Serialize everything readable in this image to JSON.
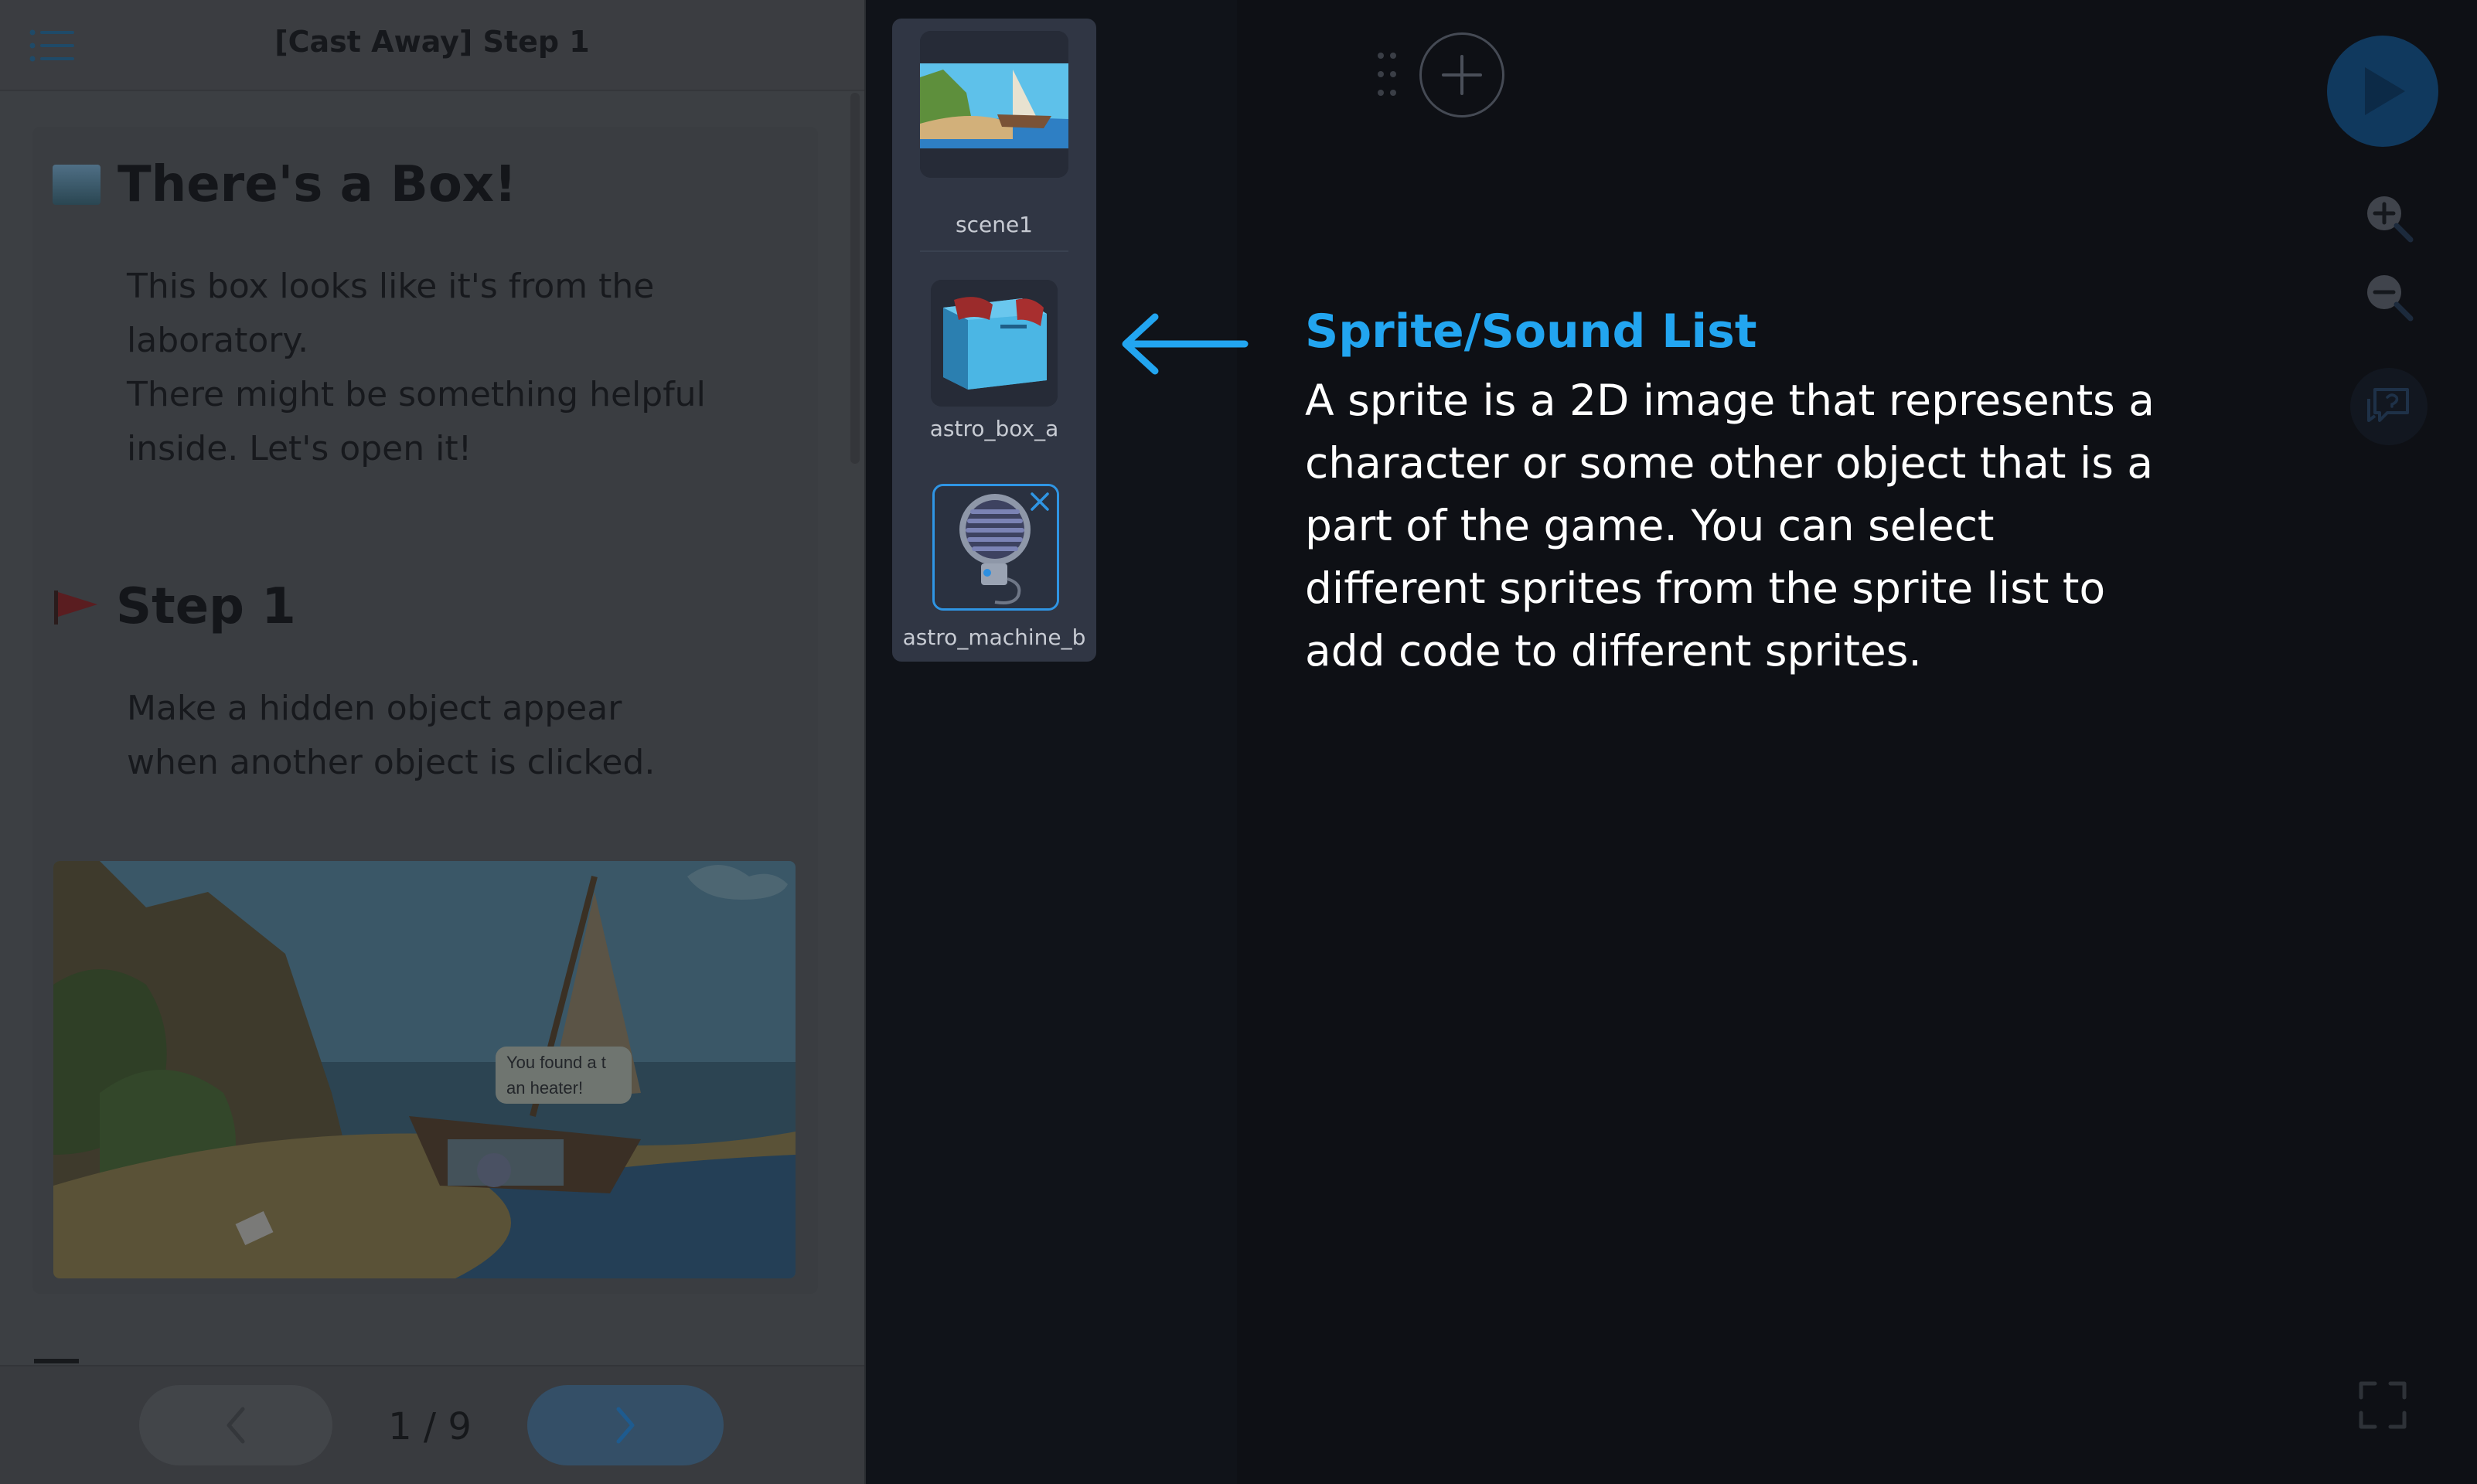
{
  "guide": {
    "title": "[Cast Away] Step 1",
    "heading": "There's a Box!",
    "intro": "This box looks like it's from the\nlaboratory.\nThere might be something helpful\ninside. Let's open it!",
    "step_heading": "Step 1",
    "step_text": "Make a hidden object appear\nwhen another object is clicked.",
    "image_caption": "You found a t\nan heater!",
    "page_indicator": "1 / 9"
  },
  "sprites": [
    {
      "label": "scene1",
      "icon": "scene-thumbnail"
    },
    {
      "label": "astro_box_a",
      "icon": "box-thumbnail"
    },
    {
      "label": "astro_machine_b",
      "icon": "heater-thumbnail",
      "selected": true
    }
  ],
  "tooltip": {
    "title": "Sprite/Sound List",
    "body": "A sprite is a 2D image that represents a\ncharacter or some other object that is a\npart of the game. You can select\ndifferent sprites from the sprite list to\nadd code to different sprites.",
    "accent_color": "#22a5f0"
  },
  "controls": {
    "play": "play-icon",
    "zoom_in": "zoom-in-icon",
    "zoom_out": "zoom-out-icon",
    "help": "help-icon",
    "fullscreen": "fullscreen-icon",
    "add": "plus-icon"
  }
}
